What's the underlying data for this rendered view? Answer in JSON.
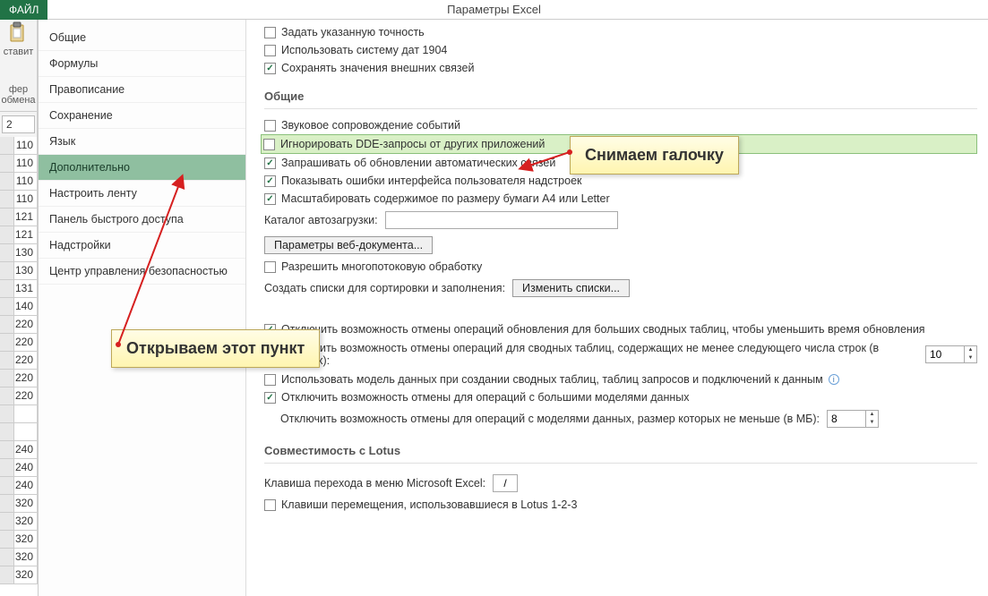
{
  "app": {
    "title": "Параметры Excel",
    "file_tab": "ФАЙЛ",
    "paste_label": "ставит",
    "buffer_label": "фер обмена",
    "cell_ref": "2"
  },
  "rows": [
    "110",
    "110",
    "110",
    "110",
    "121",
    "121",
    "130",
    "130",
    "131",
    "140",
    "220",
    "220",
    "220",
    "220",
    "220",
    "",
    "",
    "240",
    "240",
    "240",
    "320",
    "320",
    "320",
    "320",
    "320"
  ],
  "sidebar": {
    "items": [
      {
        "label": "Общие"
      },
      {
        "label": "Формулы"
      },
      {
        "label": "Правописание"
      },
      {
        "label": "Сохранение"
      },
      {
        "label": "Язык"
      },
      {
        "label": "Дополнительно",
        "selected": true
      },
      {
        "label": "Настроить ленту"
      },
      {
        "label": "Панель быстрого доступа"
      },
      {
        "label": "Надстройки"
      },
      {
        "label": "Центр управления безопасностью"
      }
    ]
  },
  "top_opts": [
    {
      "checked": false,
      "label": "Задать указанную точность"
    },
    {
      "checked": false,
      "label": "Использовать систему дат 1904"
    },
    {
      "checked": true,
      "label": "Сохранять значения внешних связей"
    }
  ],
  "g1": {
    "title": "Общие"
  },
  "g1_opts": [
    {
      "checked": false,
      "label": "Звуковое сопровождение событий"
    },
    {
      "checked": false,
      "label": "Игнорировать DDE-запросы от других приложений",
      "hi": true
    },
    {
      "checked": true,
      "label": "Запрашивать об обновлении автоматических связей"
    },
    {
      "checked": true,
      "label": "Показывать ошибки интерфейса пользователя надстроек"
    },
    {
      "checked": true,
      "label": "Масштабировать содержимое по размеру бумаги A4 или Letter"
    }
  ],
  "catalog": {
    "label": "Каталог автозагрузки:",
    "value": ""
  },
  "web_params_btn": "Параметры веб-документа...",
  "multi": {
    "checked": false,
    "label": "Разрешить многопотоковую обработку"
  },
  "lists": {
    "label": "Создать списки для сортировки и заполнения:",
    "btn": "Изменить списки..."
  },
  "pivot": {
    "o1": {
      "checked": true,
      "label": "Отключить возможность отмены операций обновления для больших сводных таблиц, чтобы уменьшить время обновления"
    },
    "o2_label": "Отключить возможность отмены операций для сводных таблиц, содержащих не менее следующего числа строк (в тысячах):",
    "o2_value": "10",
    "o3": {
      "checked": false,
      "label": "Использовать модель данных при создании сводных таблиц, таблиц запросов и подключений к данным"
    },
    "o4": {
      "checked": true,
      "label": "Отключить возможность отмены для операций с большими моделями данных"
    },
    "o5_label": "Отключить возможность отмены для операций с моделями данных, размер которых не меньше (в МБ):",
    "o5_value": "8"
  },
  "g2": {
    "title": "Совместимость с Lotus"
  },
  "lotus": {
    "key_label": "Клавиша перехода в меню Microsoft Excel:",
    "key_value": "/",
    "move": {
      "checked": false,
      "label": "Клавиши перемещения, использовавшиеся в Lotus 1-2-3"
    }
  },
  "callouts": {
    "uncheck": "Снимаем галочку",
    "open": "Открываем этот пункт"
  }
}
